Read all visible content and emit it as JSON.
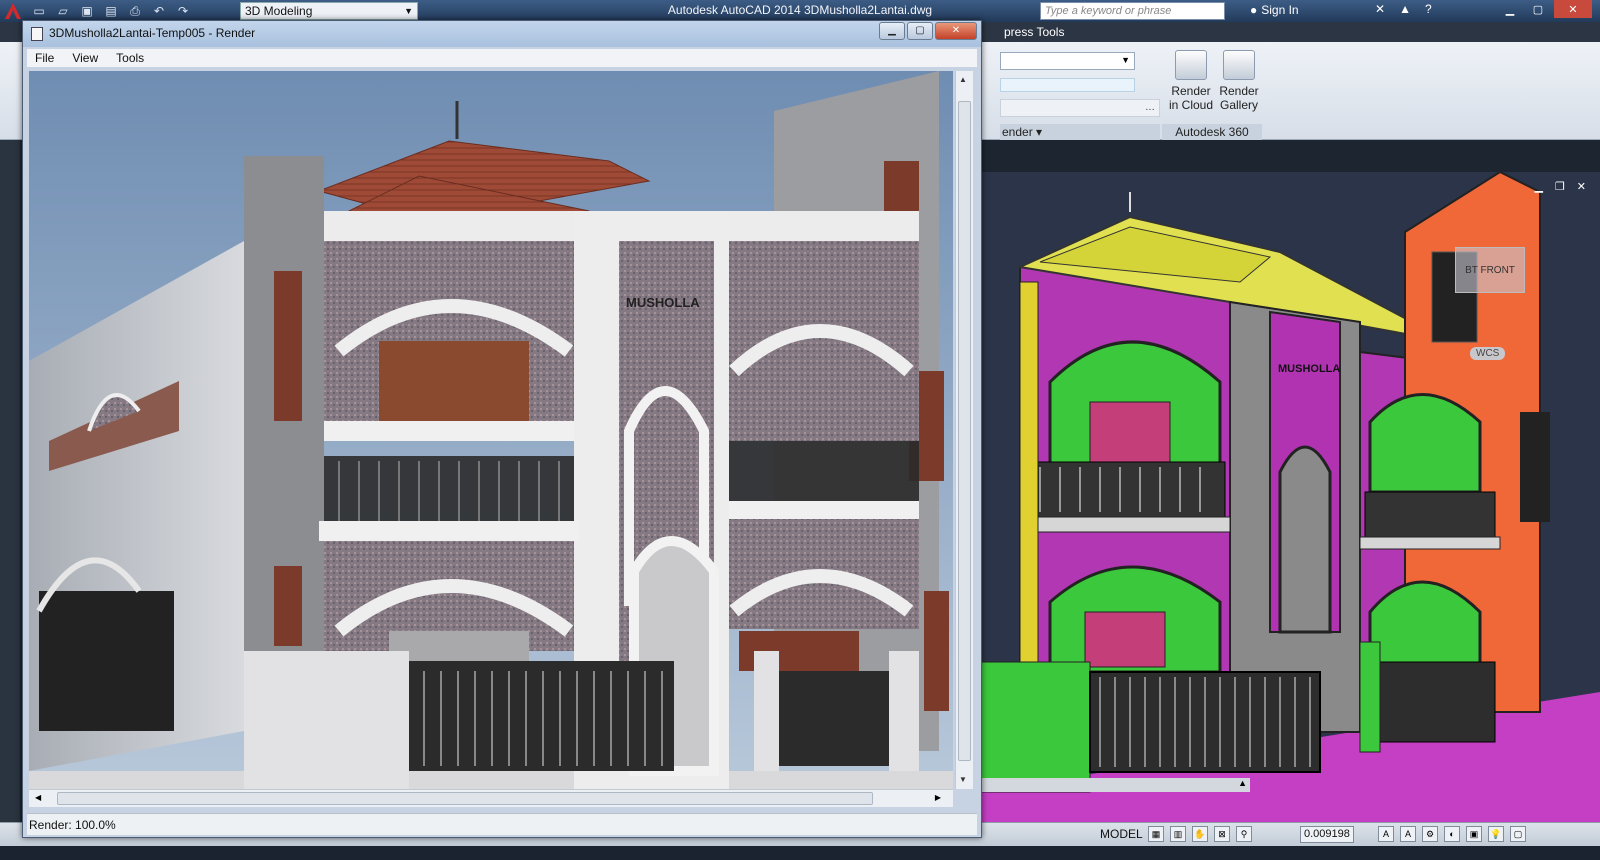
{
  "app": {
    "title": "Autodesk AutoCAD 2014    3DMusholla2Lantai.dwg",
    "workspace": "3D Modeling",
    "search_placeholder": "Type a keyword or phrase",
    "sign_in": "Sign In"
  },
  "ribbon": {
    "visible_tab_fragment": "press Tools",
    "panel_render": "ender",
    "panel_autodesk360": "Autodesk 360",
    "render_in_cloud": "Render in Cloud",
    "render_gallery": "Render Gallery"
  },
  "render_window": {
    "title": "3DMusholla2Lantai-Temp005 - Render",
    "menu": [
      "File",
      "View",
      "Tools"
    ],
    "status": "Render: 100.0%",
    "sign_text": "MUSHOLLA"
  },
  "viewport": {
    "viewcube_label": "FRONT",
    "viewcube_side": "BT",
    "wcs_label": "WCS",
    "sign_text": "MUSHOLLA"
  },
  "statusbar": {
    "model_label": "MODEL",
    "scale_value": "0.009198"
  },
  "colors": {
    "title_bar": "#2a4569",
    "render_window_frame": "#c7d3e2",
    "viewport_bg": "#2b3448",
    "roof_terracotta": "#9e4a36",
    "viewport_magenta": "#c43fc4",
    "viewport_green": "#3cc83c",
    "viewport_orange": "#f26a3a"
  }
}
